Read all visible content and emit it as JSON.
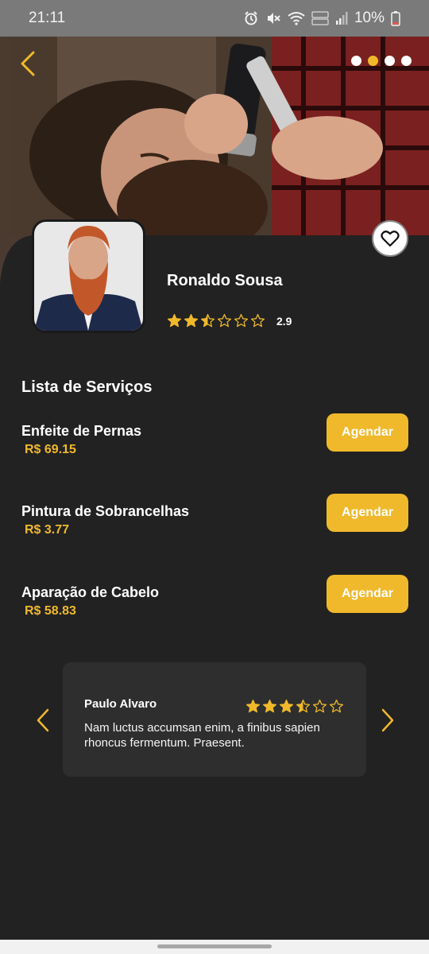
{
  "status_bar": {
    "time": "21:11",
    "battery": "10%"
  },
  "profile": {
    "name": "Ronaldo Sousa",
    "rating": 2.5,
    "rating_label": "2.9"
  },
  "carousel": {
    "total": 4,
    "active_index": 1
  },
  "services": {
    "title": "Lista de Serviços",
    "items": [
      {
        "name": "Enfeite de Pernas",
        "price": "R$ 69.15",
        "button": "Agendar"
      },
      {
        "name": "Pintura de Sobrancelhas",
        "price": "R$ 3.77",
        "button": "Agendar"
      },
      {
        "name": "Aparação de Cabelo",
        "price": "R$ 58.83",
        "button": "Agendar"
      }
    ]
  },
  "review": {
    "author": "Paulo Alvaro",
    "rating": 3.5,
    "text": "Nam luctus accumsan enim, a finibus sapien rhoncus fermentum. Praesent."
  },
  "colors": {
    "accent": "#f0b92b",
    "background": "#222222",
    "card": "#2e2e2e"
  }
}
